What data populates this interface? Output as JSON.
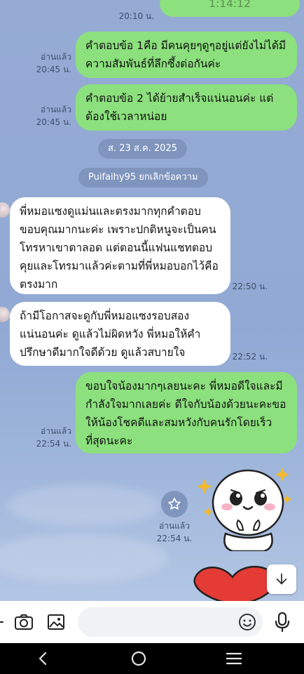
{
  "messages": [
    {
      "type": "out",
      "text": "1:14:12",
      "time": "20:10 น."
    },
    {
      "type": "out",
      "text": "คำตอบข้อ 1คือ มีคนคุยๆดูๆอยู่แต่ยังไม่ได้มีความสัมพันธ์ที่ลึกซึ้งต่อกันค่ะ",
      "read": "อ่านแล้ว",
      "time": "20:45 น."
    },
    {
      "type": "out",
      "text": "คำตอบข้อ 2 ได้ย้ายสำเร็จแน่นอนค่ะ แต่ต้องใช้เวลาหน่อย",
      "read": "อ่านแล้ว",
      "time": "20:45 น."
    },
    {
      "type": "in",
      "text": "พี่หมอแซงดูแม่นและตรงมากทุกคำตอบขอบคุณมากนะค่ะ เพราะปกติหนูจะเป็นคนโทรหาเขาตาลอด แต่ตอนนี้แฟนแชทตอบคุยและโทรมาแล้วค่ะตามที่พี่หมอบอกไว้คือตรงมาก",
      "time": "22:50 น."
    },
    {
      "type": "in",
      "text": "ถ้ามีโอกาสจะดูกับพี่หมอแซงรอบสองแน่นอนค่ะ ดูแล้วไม่ผิดหวัง พี่หมอให้คำปรึกษาดีมากใจดีด้วย ดูแล้วสบายใจ",
      "time": "22:52 น."
    },
    {
      "type": "out",
      "text": "ขอบใจน้องมากๆเลยนะคะ พี่หมอดีใจและมีกำลังใจมากเลยค่ะ ดีใจกับน้องด้วยนะคะขอให้น้องโชคดีและสมหวังกับคนรักโดยเร็วที่สุดนะคะ",
      "read": "อ่านแล้ว",
      "time": "22:54 น."
    },
    {
      "type": "sticker",
      "read": "อ่านแล้ว",
      "time": "22:54 น."
    }
  ],
  "date_separator": "ส. 23 ส.ค. 2025",
  "system_notice": "Puifaihy95 ยกเลิกข้อความ",
  "input": {
    "placeholder": ""
  },
  "icons": {
    "more": "chevron-icon",
    "camera": "camera-icon",
    "gallery": "image-icon",
    "emoji": "emoji-icon",
    "mic": "mic-icon",
    "star": "star-icon",
    "scroll_down": "arrow-down-icon",
    "nav_back": "back-icon",
    "nav_home": "home-icon",
    "nav_recent": "recent-apps-icon"
  },
  "colors": {
    "outgoing_bubble": "#8ce07d",
    "incoming_bubble": "#ffffff",
    "chat_background": "#91a9d4",
    "pill": "#7f95be"
  }
}
